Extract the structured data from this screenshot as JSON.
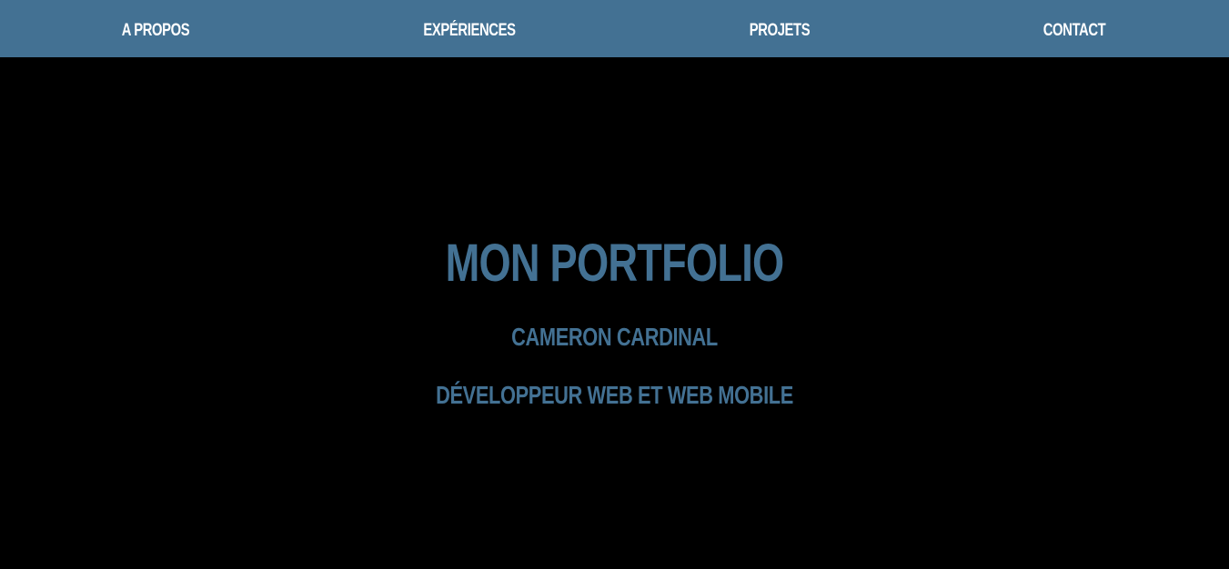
{
  "nav": {
    "items": [
      {
        "label": "A propos"
      },
      {
        "label": "Expériences"
      },
      {
        "label": "Projets"
      },
      {
        "label": "Contact"
      }
    ]
  },
  "hero": {
    "title": "Mon Portfolio",
    "name": "Cameron Cardinal",
    "role": "Développeur Web et Web Mobile"
  },
  "colors": {
    "accent": "#437193",
    "background": "#000000",
    "nav_text": "#ffffff"
  }
}
